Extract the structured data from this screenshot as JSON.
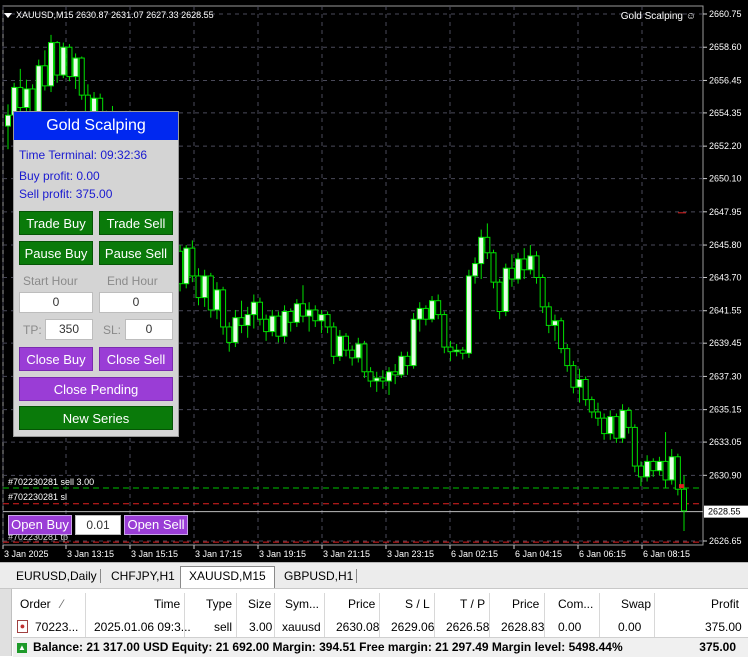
{
  "chart": {
    "header": "XAUUSD,M15  2630.87 2631.07 2627.33 2628.55",
    "ea_label": "Gold Scalping",
    "price_labels": [
      "2660.75",
      "2658.60",
      "2656.45",
      "2654.35",
      "2652.20",
      "2650.10",
      "2647.95",
      "2645.80",
      "2643.70",
      "2641.55",
      "2639.45",
      "2637.30",
      "2635.15",
      "2633.05",
      "2630.90",
      "2628.55",
      "2626.65"
    ],
    "current_price": "2628.55",
    "time_labels": [
      "3 Jan 2025",
      "3 Jan 13:15",
      "3 Jan 15:15",
      "3 Jan 17:15",
      "3 Jan 19:15",
      "3 Jan 21:15",
      "3 Jan 23:15",
      "6 Jan 02:15",
      "6 Jan 04:15",
      "6 Jan 06:15",
      "6 Jan 08:15"
    ],
    "order_labels": [
      "#702230281 sell 3.00",
      "#702230281 sl",
      "#702230281 tp"
    ],
    "colors": {
      "bg": "#000000",
      "grid": "#4a4a5a",
      "bull": "#e8fde8",
      "bear": "#000000",
      "wick": "#00e000",
      "sl": "#e02020",
      "entry": "#00c000"
    },
    "candles": [
      {
        "o": 2653.5,
        "h": 2654.9,
        "l": 2652.0,
        "c": 2654.2
      },
      {
        "o": 2654.2,
        "h": 2656.3,
        "l": 2653.6,
        "c": 2656.0
      },
      {
        "o": 2656.0,
        "h": 2657.2,
        "l": 2654.0,
        "c": 2654.7
      },
      {
        "o": 2654.7,
        "h": 2656.5,
        "l": 2653.4,
        "c": 2655.9
      },
      {
        "o": 2655.9,
        "h": 2656.2,
        "l": 2653.9,
        "c": 2654.3
      },
      {
        "o": 2654.3,
        "h": 2657.8,
        "l": 2654.0,
        "c": 2657.4
      },
      {
        "o": 2657.4,
        "h": 2658.4,
        "l": 2655.8,
        "c": 2656.1
      },
      {
        "o": 2656.1,
        "h": 2659.4,
        "l": 2655.7,
        "c": 2658.9
      },
      {
        "o": 2658.9,
        "h": 2659.0,
        "l": 2656.3,
        "c": 2656.8
      },
      {
        "o": 2656.8,
        "h": 2658.9,
        "l": 2656.6,
        "c": 2658.6
      },
      {
        "o": 2658.6,
        "h": 2658.8,
        "l": 2656.4,
        "c": 2656.7
      },
      {
        "o": 2656.7,
        "h": 2658.2,
        "l": 2655.9,
        "c": 2657.9
      },
      {
        "o": 2657.9,
        "h": 2658.0,
        "l": 2655.2,
        "c": 2655.5
      },
      {
        "o": 2655.5,
        "h": 2656.2,
        "l": 2653.9,
        "c": 2654.4
      },
      {
        "o": 2654.4,
        "h": 2655.7,
        "l": 2653.8,
        "c": 2655.3
      },
      {
        "o": 2655.3,
        "h": 2655.6,
        "l": 2652.8,
        "c": 2653.7
      },
      {
        "o": 2653.7,
        "h": 2654.5,
        "l": 2652.6,
        "c": 2654.2
      },
      {
        "o": 2654.2,
        "h": 2654.8,
        "l": 2651.0,
        "c": 2651.4
      },
      {
        "o": 2651.4,
        "h": 2651.8,
        "l": 2649.8,
        "c": 2650.4
      },
      {
        "o": 2650.4,
        "h": 2650.6,
        "l": 2647.5,
        "c": 2647.8
      },
      {
        "o": 2647.8,
        "h": 2648.2,
        "l": 2646.2,
        "c": 2646.6
      },
      {
        "o": 2646.6,
        "h": 2647.9,
        "l": 2646.0,
        "c": 2647.4
      },
      {
        "o": 2647.4,
        "h": 2648.1,
        "l": 2645.2,
        "c": 2645.6
      },
      {
        "o": 2645.6,
        "h": 2647.4,
        "l": 2644.8,
        "c": 2646.9
      },
      {
        "o": 2646.9,
        "h": 2647.4,
        "l": 2643.0,
        "c": 2643.4
      },
      {
        "o": 2643.4,
        "h": 2650.4,
        "l": 2643.0,
        "c": 2650.1
      },
      {
        "o": 2650.1,
        "h": 2650.4,
        "l": 2641.8,
        "c": 2642.2
      },
      {
        "o": 2642.2,
        "h": 2646.2,
        "l": 2641.6,
        "c": 2645.4
      },
      {
        "o": 2645.4,
        "h": 2645.8,
        "l": 2642.8,
        "c": 2643.3
      },
      {
        "o": 2643.3,
        "h": 2645.8,
        "l": 2643.0,
        "c": 2645.6
      },
      {
        "o": 2645.6,
        "h": 2646.1,
        "l": 2643.4,
        "c": 2643.8
      },
      {
        "o": 2643.8,
        "h": 2644.3,
        "l": 2641.9,
        "c": 2642.4
      },
      {
        "o": 2642.4,
        "h": 2644.2,
        "l": 2641.8,
        "c": 2643.8
      },
      {
        "o": 2643.8,
        "h": 2644.0,
        "l": 2641.1,
        "c": 2641.6
      },
      {
        "o": 2641.6,
        "h": 2643.4,
        "l": 2641.0,
        "c": 2642.9
      },
      {
        "o": 2642.9,
        "h": 2643.1,
        "l": 2640.0,
        "c": 2640.5
      },
      {
        "o": 2640.5,
        "h": 2640.8,
        "l": 2638.9,
        "c": 2639.5
      },
      {
        "o": 2639.5,
        "h": 2641.6,
        "l": 2639.2,
        "c": 2641.1
      },
      {
        "o": 2641.1,
        "h": 2642.2,
        "l": 2640.1,
        "c": 2640.6
      },
      {
        "o": 2640.6,
        "h": 2641.8,
        "l": 2639.8,
        "c": 2641.3
      },
      {
        "o": 2641.3,
        "h": 2642.6,
        "l": 2640.4,
        "c": 2642.1
      },
      {
        "o": 2642.1,
        "h": 2642.4,
        "l": 2640.6,
        "c": 2641.0
      },
      {
        "o": 2641.0,
        "h": 2641.3,
        "l": 2639.6,
        "c": 2640.2
      },
      {
        "o": 2640.2,
        "h": 2641.6,
        "l": 2639.9,
        "c": 2641.2
      },
      {
        "o": 2641.2,
        "h": 2641.5,
        "l": 2639.5,
        "c": 2639.9
      },
      {
        "o": 2639.9,
        "h": 2641.9,
        "l": 2639.5,
        "c": 2641.5
      },
      {
        "o": 2641.5,
        "h": 2641.7,
        "l": 2640.2,
        "c": 2640.8
      },
      {
        "o": 2640.8,
        "h": 2642.3,
        "l": 2640.5,
        "c": 2642.0
      },
      {
        "o": 2642.0,
        "h": 2643.2,
        "l": 2640.8,
        "c": 2641.2
      },
      {
        "o": 2641.2,
        "h": 2642.1,
        "l": 2640.2,
        "c": 2641.6
      },
      {
        "o": 2641.6,
        "h": 2641.9,
        "l": 2640.5,
        "c": 2640.9
      },
      {
        "o": 2640.9,
        "h": 2641.6,
        "l": 2640.1,
        "c": 2641.3
      },
      {
        "o": 2641.3,
        "h": 2641.5,
        "l": 2640.1,
        "c": 2640.5
      },
      {
        "o": 2640.5,
        "h": 2640.8,
        "l": 2638.1,
        "c": 2638.6
      },
      {
        "o": 2638.6,
        "h": 2640.3,
        "l": 2638.3,
        "c": 2639.9
      },
      {
        "o": 2639.9,
        "h": 2640.1,
        "l": 2638.6,
        "c": 2639.0
      },
      {
        "o": 2639.0,
        "h": 2639.3,
        "l": 2638.0,
        "c": 2638.5
      },
      {
        "o": 2638.5,
        "h": 2639.8,
        "l": 2638.2,
        "c": 2639.4
      },
      {
        "o": 2639.4,
        "h": 2639.6,
        "l": 2637.2,
        "c": 2637.6
      },
      {
        "o": 2637.6,
        "h": 2637.9,
        "l": 2636.6,
        "c": 2637.0
      },
      {
        "o": 2637.0,
        "h": 2637.6,
        "l": 2636.3,
        "c": 2637.2
      },
      {
        "o": 2637.2,
        "h": 2637.7,
        "l": 2636.5,
        "c": 2637.0
      },
      {
        "o": 2637.0,
        "h": 2637.9,
        "l": 2636.1,
        "c": 2637.6
      },
      {
        "o": 2637.6,
        "h": 2638.1,
        "l": 2636.8,
        "c": 2637.4
      },
      {
        "o": 2637.4,
        "h": 2638.9,
        "l": 2637.2,
        "c": 2638.6
      },
      {
        "o": 2638.6,
        "h": 2638.9,
        "l": 2637.4,
        "c": 2638.0
      },
      {
        "o": 2638.0,
        "h": 2641.4,
        "l": 2637.8,
        "c": 2641.0
      },
      {
        "o": 2641.0,
        "h": 2642.1,
        "l": 2640.2,
        "c": 2641.7
      },
      {
        "o": 2641.7,
        "h": 2641.9,
        "l": 2640.6,
        "c": 2641.0
      },
      {
        "o": 2641.0,
        "h": 2642.5,
        "l": 2640.8,
        "c": 2642.2
      },
      {
        "o": 2642.2,
        "h": 2642.6,
        "l": 2641.0,
        "c": 2641.3
      },
      {
        "o": 2641.3,
        "h": 2641.5,
        "l": 2638.8,
        "c": 2639.2
      },
      {
        "o": 2639.2,
        "h": 2639.6,
        "l": 2638.3,
        "c": 2638.9
      },
      {
        "o": 2638.9,
        "h": 2639.4,
        "l": 2638.6,
        "c": 2639.0
      },
      {
        "o": 2639.0,
        "h": 2639.2,
        "l": 2638.4,
        "c": 2638.8
      },
      {
        "o": 2638.8,
        "h": 2644.2,
        "l": 2638.5,
        "c": 2643.8
      },
      {
        "o": 2643.8,
        "h": 2645.0,
        "l": 2643.3,
        "c": 2644.6
      },
      {
        "o": 2644.6,
        "h": 2646.8,
        "l": 2643.6,
        "c": 2646.3
      },
      {
        "o": 2646.3,
        "h": 2647.2,
        "l": 2644.9,
        "c": 2645.3
      },
      {
        "o": 2645.3,
        "h": 2645.5,
        "l": 2643.0,
        "c": 2643.4
      },
      {
        "o": 2643.4,
        "h": 2643.6,
        "l": 2641.0,
        "c": 2641.5
      },
      {
        "o": 2641.5,
        "h": 2644.6,
        "l": 2641.2,
        "c": 2644.3
      },
      {
        "o": 2644.3,
        "h": 2645.2,
        "l": 2643.1,
        "c": 2643.6
      },
      {
        "o": 2643.6,
        "h": 2645.3,
        "l": 2643.3,
        "c": 2644.9
      },
      {
        "o": 2644.9,
        "h": 2645.6,
        "l": 2643.6,
        "c": 2644.2
      },
      {
        "o": 2644.2,
        "h": 2645.8,
        "l": 2643.9,
        "c": 2645.1
      },
      {
        "o": 2645.1,
        "h": 2645.4,
        "l": 2643.3,
        "c": 2643.7
      },
      {
        "o": 2643.7,
        "h": 2643.9,
        "l": 2641.4,
        "c": 2641.8
      },
      {
        "o": 2641.8,
        "h": 2642.1,
        "l": 2640.1,
        "c": 2640.6
      },
      {
        "o": 2640.6,
        "h": 2641.3,
        "l": 2639.6,
        "c": 2640.9
      },
      {
        "o": 2640.9,
        "h": 2641.1,
        "l": 2638.8,
        "c": 2639.1
      },
      {
        "o": 2639.1,
        "h": 2639.4,
        "l": 2637.6,
        "c": 2638.0
      },
      {
        "o": 2638.0,
        "h": 2638.3,
        "l": 2636.2,
        "c": 2636.6
      },
      {
        "o": 2636.6,
        "h": 2637.8,
        "l": 2635.6,
        "c": 2637.1
      },
      {
        "o": 2637.1,
        "h": 2637.3,
        "l": 2635.4,
        "c": 2635.8
      },
      {
        "o": 2635.8,
        "h": 2636.0,
        "l": 2634.6,
        "c": 2635.0
      },
      {
        "o": 2635.0,
        "h": 2635.6,
        "l": 2634.1,
        "c": 2634.6
      },
      {
        "o": 2634.6,
        "h": 2634.9,
        "l": 2633.2,
        "c": 2633.6
      },
      {
        "o": 2633.6,
        "h": 2635.1,
        "l": 2633.2,
        "c": 2634.7
      },
      {
        "o": 2634.7,
        "h": 2634.9,
        "l": 2633.0,
        "c": 2633.3
      },
      {
        "o": 2633.3,
        "h": 2635.5,
        "l": 2633.0,
        "c": 2635.1
      },
      {
        "o": 2635.1,
        "h": 2635.3,
        "l": 2633.6,
        "c": 2634.0
      },
      {
        "o": 2634.0,
        "h": 2634.2,
        "l": 2631.1,
        "c": 2631.5
      },
      {
        "o": 2631.5,
        "h": 2631.8,
        "l": 2630.2,
        "c": 2630.8
      },
      {
        "o": 2630.8,
        "h": 2632.2,
        "l": 2630.5,
        "c": 2631.8
      },
      {
        "o": 2631.8,
        "h": 2632.0,
        "l": 2630.8,
        "c": 2631.2
      },
      {
        "o": 2631.2,
        "h": 2632.1,
        "l": 2630.9,
        "c": 2631.8
      },
      {
        "o": 2631.8,
        "h": 2633.7,
        "l": 2630.1,
        "c": 2630.6
      },
      {
        "o": 2630.6,
        "h": 2632.6,
        "l": 2630.3,
        "c": 2632.1
      },
      {
        "o": 2632.1,
        "h": 2632.3,
        "l": 2629.6,
        "c": 2630.0
      },
      {
        "o": 2630.0,
        "h": 2630.9,
        "l": 2627.3,
        "c": 2628.6
      }
    ],
    "lines": {
      "entry": 2630.08,
      "sl": 2629.06,
      "tp": 2626.58
    }
  },
  "panel": {
    "title": "Gold Scalping",
    "time_terminal": "Time Terminal: 09:32:36",
    "buy_profit": "Buy profit: 0.00",
    "sell_profit": "Sell profit: 375.00",
    "trade_buy": "Trade Buy",
    "trade_sell": "Trade Sell",
    "pause_buy": "Pause Buy",
    "pause_sell": "Pause Sell",
    "start_hour_label": "Start Hour",
    "end_hour_label": "End Hour",
    "start_hour": "0",
    "end_hour": "0",
    "tp_label": "TP:",
    "tp_value": "350",
    "sl_label": "SL:",
    "sl_value": "0",
    "close_buy": "Close Buy",
    "close_sell": "Close Sell",
    "close_pending": "Close Pending",
    "new_series": "New Series"
  },
  "order_bar": {
    "open_buy": "Open Buy",
    "lot": "0.01",
    "open_sell": "Open Sell"
  },
  "tabs": [
    "EURUSD,Daily",
    "CHFJPY,H1",
    "XAUUSD,M15",
    "GBPUSD,H1"
  ],
  "active_tab": "XAUUSD,M15",
  "table": {
    "headers": [
      "Order",
      "Time",
      "Type",
      "Size",
      "Sym...",
      "Price",
      "S / L",
      "T / P",
      "Price",
      "Com...",
      "Swap",
      "Profit"
    ],
    "row": [
      "70223...",
      "2025.01.06 09:3...",
      "sell",
      "3.00",
      "xauusd",
      "2630.08",
      "2629.06",
      "2626.58",
      "2628.83",
      "0.00",
      "0.00",
      "375.00"
    ],
    "balance": "Balance: 21 317.00 USD  Equity: 21 692.00  Margin: 394.51  Free margin: 21 297.49  Margin level: 5498.44%",
    "balance_profit": "375.00"
  }
}
